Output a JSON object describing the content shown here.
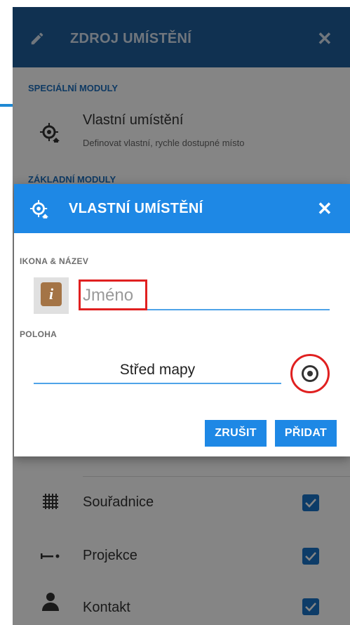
{
  "background_sheet": {
    "title": "ZDROJ UMÍSTĚNÍ",
    "close_glyph": "✕",
    "special_section": "SPECIÁLNÍ MODULY",
    "custom_location": {
      "title": "Vlastní umístění",
      "subtitle": "Definovat vlastní, rychle dostupné místo",
      "icon": "location-target-icon"
    },
    "basic_section": "ZÁKLADNÍ MODULY",
    "modules": [
      {
        "label": "Souřadnice",
        "icon": "grid-icon",
        "checked": true
      },
      {
        "label": "Projekce",
        "icon": "projection-icon",
        "checked": true
      },
      {
        "label": "Kontakt",
        "icon": "person-icon",
        "checked": true
      }
    ]
  },
  "dialog": {
    "title": "VLASTNÍ UMÍSTĚNÍ",
    "close_glyph": "✕",
    "icon_name_label": "IKONA & NÁZEV",
    "name_placeholder": "Jméno",
    "name_value": "",
    "position_label": "POLOHA",
    "position_value": "Střed mapy",
    "cancel_label": "ZRUŠIT",
    "add_label": "PŘIDAT"
  },
  "colors": {
    "background_header": "#1f5f9c",
    "dialog_header": "#1e88e5",
    "button": "#1e88e5",
    "highlight": "#e02020",
    "poi_icon": "#a47446"
  }
}
